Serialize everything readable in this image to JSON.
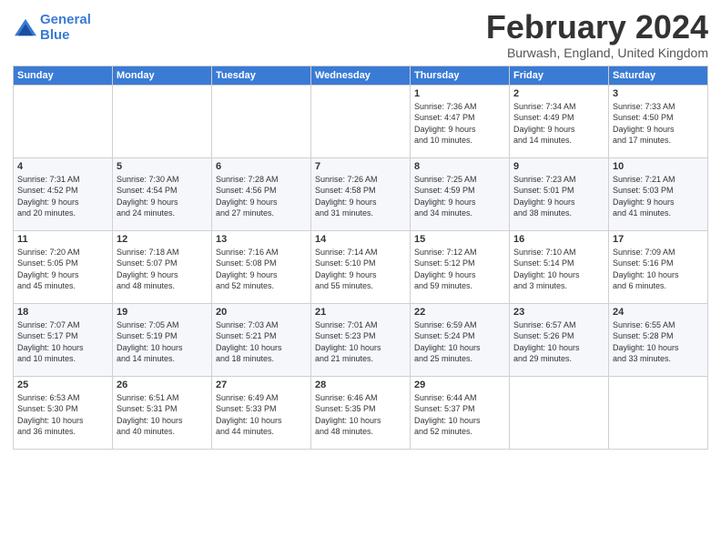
{
  "header": {
    "logo_line1": "General",
    "logo_line2": "Blue",
    "month_title": "February 2024",
    "location": "Burwash, England, United Kingdom"
  },
  "days_of_week": [
    "Sunday",
    "Monday",
    "Tuesday",
    "Wednesday",
    "Thursday",
    "Friday",
    "Saturday"
  ],
  "weeks": [
    [
      {
        "day": "",
        "text": ""
      },
      {
        "day": "",
        "text": ""
      },
      {
        "day": "",
        "text": ""
      },
      {
        "day": "",
        "text": ""
      },
      {
        "day": "1",
        "text": "Sunrise: 7:36 AM\nSunset: 4:47 PM\nDaylight: 9 hours\nand 10 minutes."
      },
      {
        "day": "2",
        "text": "Sunrise: 7:34 AM\nSunset: 4:49 PM\nDaylight: 9 hours\nand 14 minutes."
      },
      {
        "day": "3",
        "text": "Sunrise: 7:33 AM\nSunset: 4:50 PM\nDaylight: 9 hours\nand 17 minutes."
      }
    ],
    [
      {
        "day": "4",
        "text": "Sunrise: 7:31 AM\nSunset: 4:52 PM\nDaylight: 9 hours\nand 20 minutes."
      },
      {
        "day": "5",
        "text": "Sunrise: 7:30 AM\nSunset: 4:54 PM\nDaylight: 9 hours\nand 24 minutes."
      },
      {
        "day": "6",
        "text": "Sunrise: 7:28 AM\nSunset: 4:56 PM\nDaylight: 9 hours\nand 27 minutes."
      },
      {
        "day": "7",
        "text": "Sunrise: 7:26 AM\nSunset: 4:58 PM\nDaylight: 9 hours\nand 31 minutes."
      },
      {
        "day": "8",
        "text": "Sunrise: 7:25 AM\nSunset: 4:59 PM\nDaylight: 9 hours\nand 34 minutes."
      },
      {
        "day": "9",
        "text": "Sunrise: 7:23 AM\nSunset: 5:01 PM\nDaylight: 9 hours\nand 38 minutes."
      },
      {
        "day": "10",
        "text": "Sunrise: 7:21 AM\nSunset: 5:03 PM\nDaylight: 9 hours\nand 41 minutes."
      }
    ],
    [
      {
        "day": "11",
        "text": "Sunrise: 7:20 AM\nSunset: 5:05 PM\nDaylight: 9 hours\nand 45 minutes."
      },
      {
        "day": "12",
        "text": "Sunrise: 7:18 AM\nSunset: 5:07 PM\nDaylight: 9 hours\nand 48 minutes."
      },
      {
        "day": "13",
        "text": "Sunrise: 7:16 AM\nSunset: 5:08 PM\nDaylight: 9 hours\nand 52 minutes."
      },
      {
        "day": "14",
        "text": "Sunrise: 7:14 AM\nSunset: 5:10 PM\nDaylight: 9 hours\nand 55 minutes."
      },
      {
        "day": "15",
        "text": "Sunrise: 7:12 AM\nSunset: 5:12 PM\nDaylight: 9 hours\nand 59 minutes."
      },
      {
        "day": "16",
        "text": "Sunrise: 7:10 AM\nSunset: 5:14 PM\nDaylight: 10 hours\nand 3 minutes."
      },
      {
        "day": "17",
        "text": "Sunrise: 7:09 AM\nSunset: 5:16 PM\nDaylight: 10 hours\nand 6 minutes."
      }
    ],
    [
      {
        "day": "18",
        "text": "Sunrise: 7:07 AM\nSunset: 5:17 PM\nDaylight: 10 hours\nand 10 minutes."
      },
      {
        "day": "19",
        "text": "Sunrise: 7:05 AM\nSunset: 5:19 PM\nDaylight: 10 hours\nand 14 minutes."
      },
      {
        "day": "20",
        "text": "Sunrise: 7:03 AM\nSunset: 5:21 PM\nDaylight: 10 hours\nand 18 minutes."
      },
      {
        "day": "21",
        "text": "Sunrise: 7:01 AM\nSunset: 5:23 PM\nDaylight: 10 hours\nand 21 minutes."
      },
      {
        "day": "22",
        "text": "Sunrise: 6:59 AM\nSunset: 5:24 PM\nDaylight: 10 hours\nand 25 minutes."
      },
      {
        "day": "23",
        "text": "Sunrise: 6:57 AM\nSunset: 5:26 PM\nDaylight: 10 hours\nand 29 minutes."
      },
      {
        "day": "24",
        "text": "Sunrise: 6:55 AM\nSunset: 5:28 PM\nDaylight: 10 hours\nand 33 minutes."
      }
    ],
    [
      {
        "day": "25",
        "text": "Sunrise: 6:53 AM\nSunset: 5:30 PM\nDaylight: 10 hours\nand 36 minutes."
      },
      {
        "day": "26",
        "text": "Sunrise: 6:51 AM\nSunset: 5:31 PM\nDaylight: 10 hours\nand 40 minutes."
      },
      {
        "day": "27",
        "text": "Sunrise: 6:49 AM\nSunset: 5:33 PM\nDaylight: 10 hours\nand 44 minutes."
      },
      {
        "day": "28",
        "text": "Sunrise: 6:46 AM\nSunset: 5:35 PM\nDaylight: 10 hours\nand 48 minutes."
      },
      {
        "day": "29",
        "text": "Sunrise: 6:44 AM\nSunset: 5:37 PM\nDaylight: 10 hours\nand 52 minutes."
      },
      {
        "day": "",
        "text": ""
      },
      {
        "day": "",
        "text": ""
      }
    ]
  ]
}
